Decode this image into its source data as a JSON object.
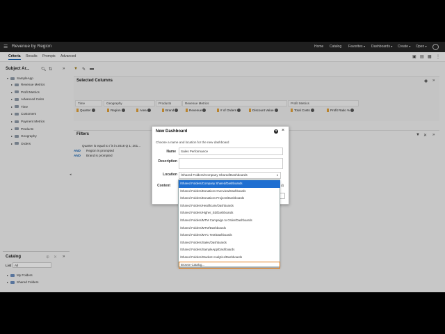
{
  "app": {
    "title": "Revenue by Region"
  },
  "topnav": {
    "home": "Home",
    "catalog": "Catalog",
    "favorites": "Favorites",
    "dashboards": "Dashboards",
    "create": "Create",
    "open": "Open"
  },
  "tabs": [
    "Criteria",
    "Results",
    "Prompts",
    "Advanced"
  ],
  "subject_area": {
    "title": "Subject Ar...",
    "root": "SampleApp",
    "folders": [
      "Revenue Metrics",
      "Profit Metrics",
      "Advanced Calcs",
      "Time",
      "Customers",
      "Payment Metrics",
      "Products",
      "Geography",
      "Orders"
    ]
  },
  "catalog": {
    "title": "Catalog",
    "list_label": "List",
    "list_value": "All",
    "folders": [
      "My Folders",
      "Shared Folders"
    ]
  },
  "selected_columns": {
    "title": "Selected Columns",
    "groups": [
      "Time",
      "Geography",
      "Products",
      "Revenue Metrics",
      "Profit Metrics"
    ],
    "columns": [
      "Quarter",
      "Region",
      "Area",
      "Brand",
      "Revenue",
      "# of Orders",
      "Discount Value",
      "Total Costs",
      "Profit Ratio %"
    ]
  },
  "filters": {
    "title": "Filters",
    "items": [
      "Quarter is equal to / is in  2018 Q 1; 201...",
      "Region is prompted",
      "Brand is prompted"
    ],
    "and_label": "AND"
  },
  "dialog": {
    "title": "New Dashboard",
    "subtitle": "Choose a name and location for the new dashboard",
    "name_label": "Name",
    "name_value": "Sales Performance",
    "description_label": "Description",
    "location_label": "Location",
    "location_value": "/Shared Folders/Company Shared/Dashboards",
    "content_label": "Content",
    "content_peek": "d)"
  },
  "location_options": [
    "/Shared Folders/Company Shared/Dashboards",
    "/Shared Folders/Donations Overview/Dashboards",
    "/Shared Folders/Donations Projects/Dashboards",
    "/Shared Folders/Healthcare/Dashboards",
    "/Shared Folders/Higher_Ed/Dashboards",
    "/Shared Folders/MTM Campaign to Order/Dashboards",
    "/Shared Folders/MTM/Dashboards",
    "/Shared Folders/MYC Test/Dashboards",
    "/Shared Folders/Sales/Dashboards",
    "/Shared Folders/SampleApp/Dashboards",
    "/Shared Folders/Student Analytics/Dashboards",
    "Browse Catalog..."
  ],
  "colors": {
    "accent": "#1f6fd1",
    "highlight": "#e07b18",
    "topbar": "#262626"
  }
}
